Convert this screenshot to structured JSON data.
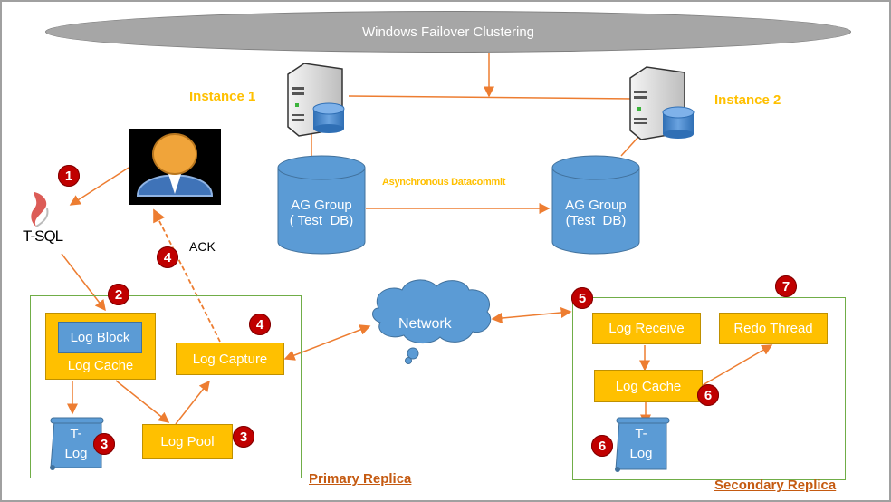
{
  "cluster": {
    "label": "Windows Failover Clustering"
  },
  "instances": [
    {
      "label": "Instance 1",
      "icon": "server-database-icon"
    },
    {
      "label": "Instance 2",
      "icon": "server-database-icon"
    }
  ],
  "databases": [
    {
      "line1": "AG Group",
      "line2": "( Test_DB)"
    },
    {
      "line1": "AG Group",
      "line2": "(Test_DB)"
    }
  ],
  "async_label": "Asynchronous Datacommit",
  "client": {
    "tsql_label": "T-SQL",
    "user_icon": "user-icon",
    "ack_label": "ACK"
  },
  "network": {
    "label": "Network"
  },
  "primary": {
    "title": "Primary Replica",
    "log_block": "Log Block",
    "log_cache": "Log Cache",
    "log_capture": "Log Capture",
    "log_pool": "Log Pool",
    "tlog_line1": "T-",
    "tlog_line2": "Log"
  },
  "secondary": {
    "title": "Secondary Replica",
    "log_receive": "Log Receive",
    "redo_thread": "Redo Thread",
    "log_cache": "Log Cache",
    "tlog_line1": "T-",
    "tlog_line2": "Log"
  },
  "steps": [
    "1",
    "2",
    "3",
    "3",
    "4",
    "4",
    "5",
    "6",
    "6",
    "7"
  ],
  "colors": {
    "arrow": "#ed7d31",
    "yellow_box": "#ffc000",
    "blue_shape": "#5b9bd5",
    "badge": "#c00000",
    "group_border": "#70ad47",
    "replica_label": "#c55a11",
    "instance_label": "#ffc000"
  }
}
